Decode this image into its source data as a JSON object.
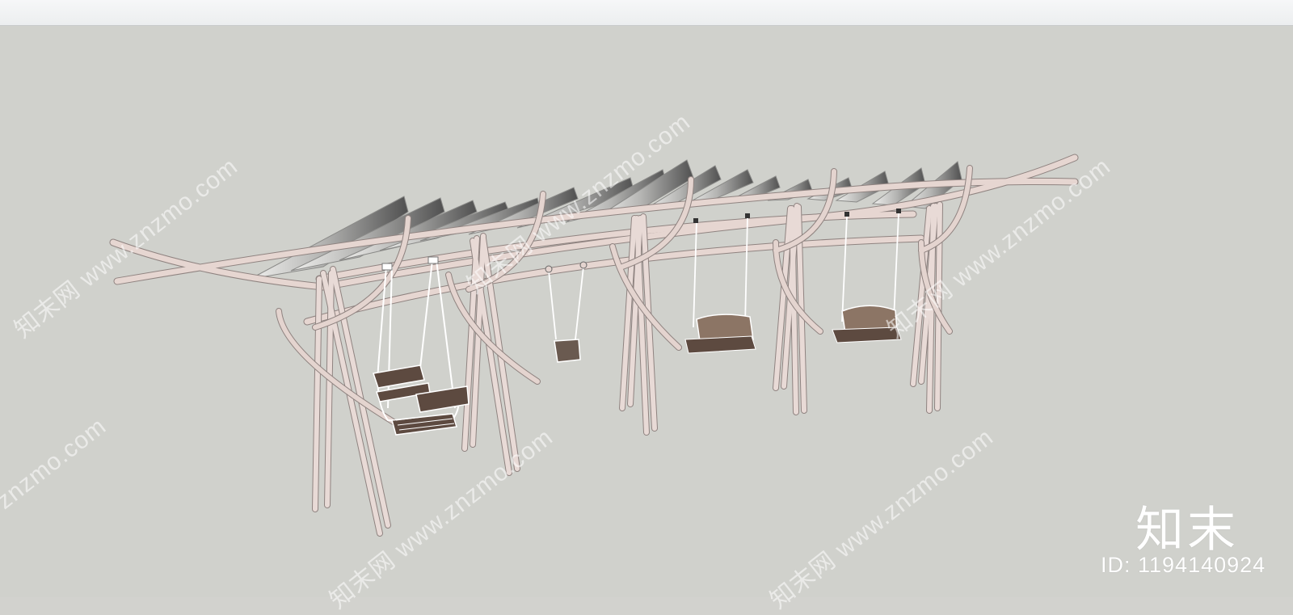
{
  "watermark": {
    "domain": "www.znzmo.com",
    "domain_short": "znzmo.com",
    "chinese": "知末网"
  },
  "brand": {
    "logo_text": "知末",
    "image_id": "ID: 1194140924"
  },
  "scene": {
    "subject_icon": "swing-pergola-model",
    "colors": {
      "viewport_bg": "#d0d1cc",
      "frame": "#e4d4cf",
      "frame_edge": "#8f8380",
      "canopy_light": "#ececea",
      "canopy_dark": "#5f5f5f",
      "wood": "#5d4a40",
      "chain": "#ffffff"
    }
  }
}
